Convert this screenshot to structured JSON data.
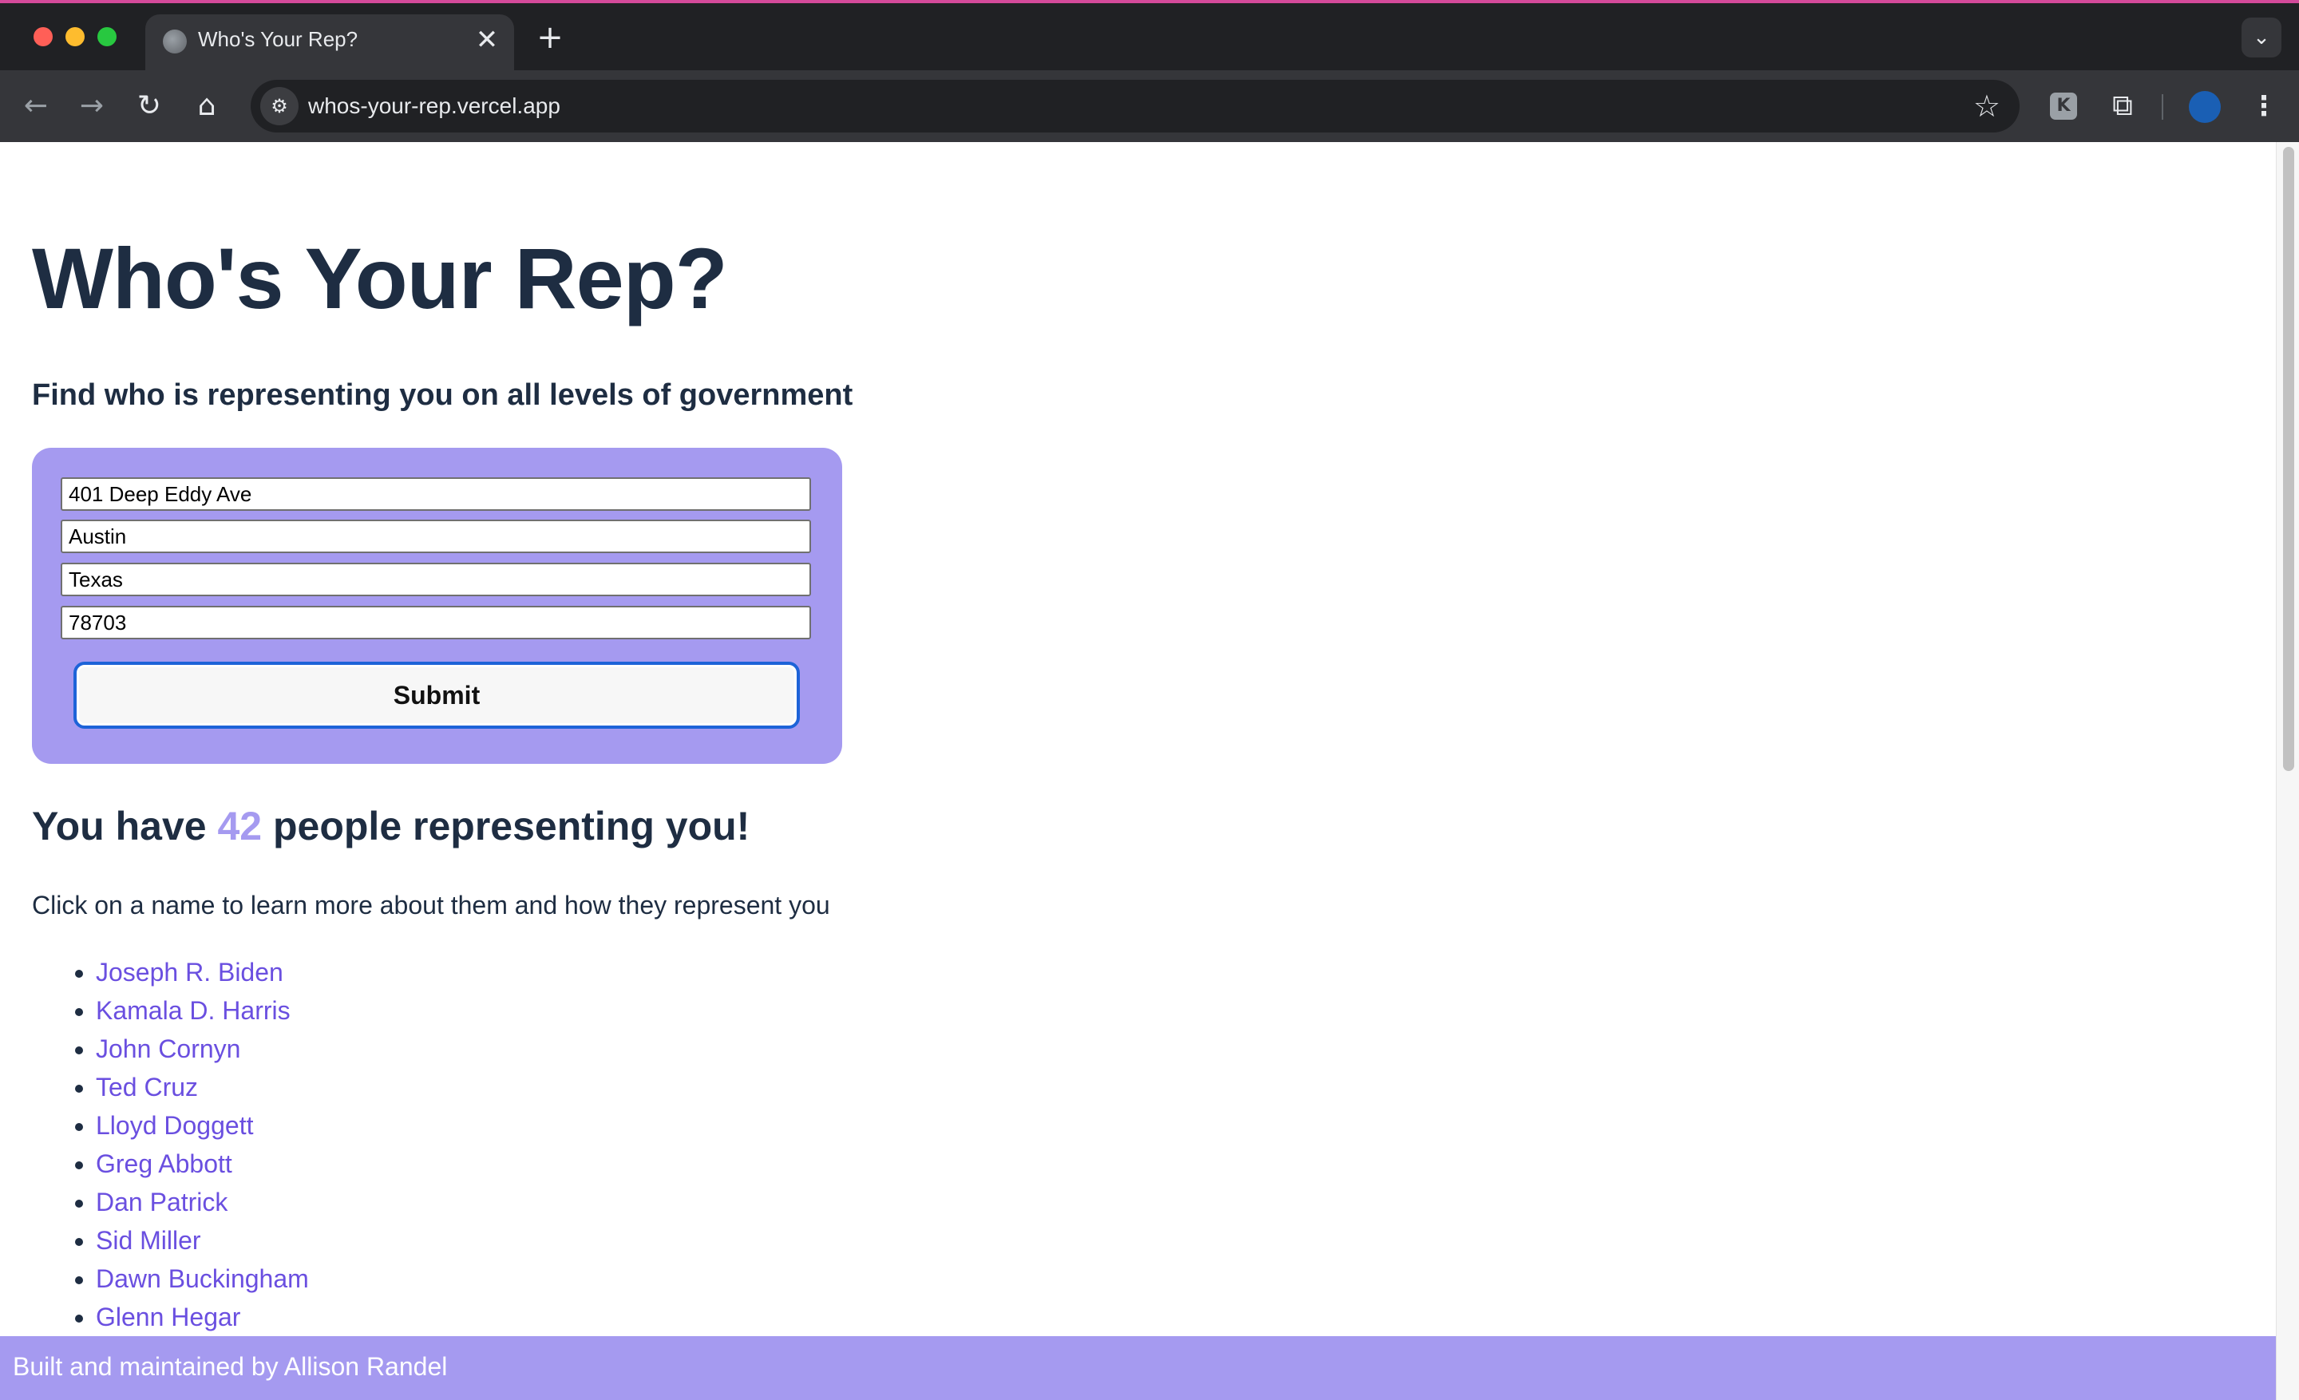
{
  "browser": {
    "tab_title": "Who's Your Rep?",
    "tab_close_glyph": "✕",
    "new_tab_glyph": "+",
    "tab_menu_glyph": "⌄",
    "url": "whos-your-rep.vercel.app",
    "nav": {
      "back_glyph": "←",
      "forward_glyph": "→",
      "reload_glyph": "↻",
      "home_glyph": "⌂"
    },
    "site_info_glyph": "⚙",
    "bookmark_glyph": "☆",
    "extension_k_glyph": "K",
    "extensions_glyph": "⧉",
    "menu_glyph": "⋮"
  },
  "page": {
    "title": "Who's Your Rep?",
    "subtitle": "Find who is representing you on all levels of government",
    "form": {
      "street": "401 Deep Eddy Ave",
      "city": "Austin",
      "state": "Texas",
      "zip": "78703",
      "submit_label": "Submit"
    },
    "results": {
      "prefix": "You have ",
      "count": "42",
      "suffix": " people representing you!",
      "instructions": "Click on a name to learn more about them and how they represent you",
      "representatives": [
        "Joseph R. Biden",
        "Kamala D. Harris",
        "John Cornyn",
        "Ted Cruz",
        "Lloyd Doggett",
        "Greg Abbott",
        "Dan Patrick",
        "Sid Miller",
        "Dawn Buckingham",
        "Glenn Hegar"
      ]
    },
    "footer": "Built and maintained by Allison Randel"
  },
  "colors": {
    "accent": "#a59af0",
    "link": "#6a4fe0",
    "heading": "#1e2d42",
    "chrome_dark": "#202124",
    "chrome_toolbar": "#35363a"
  }
}
